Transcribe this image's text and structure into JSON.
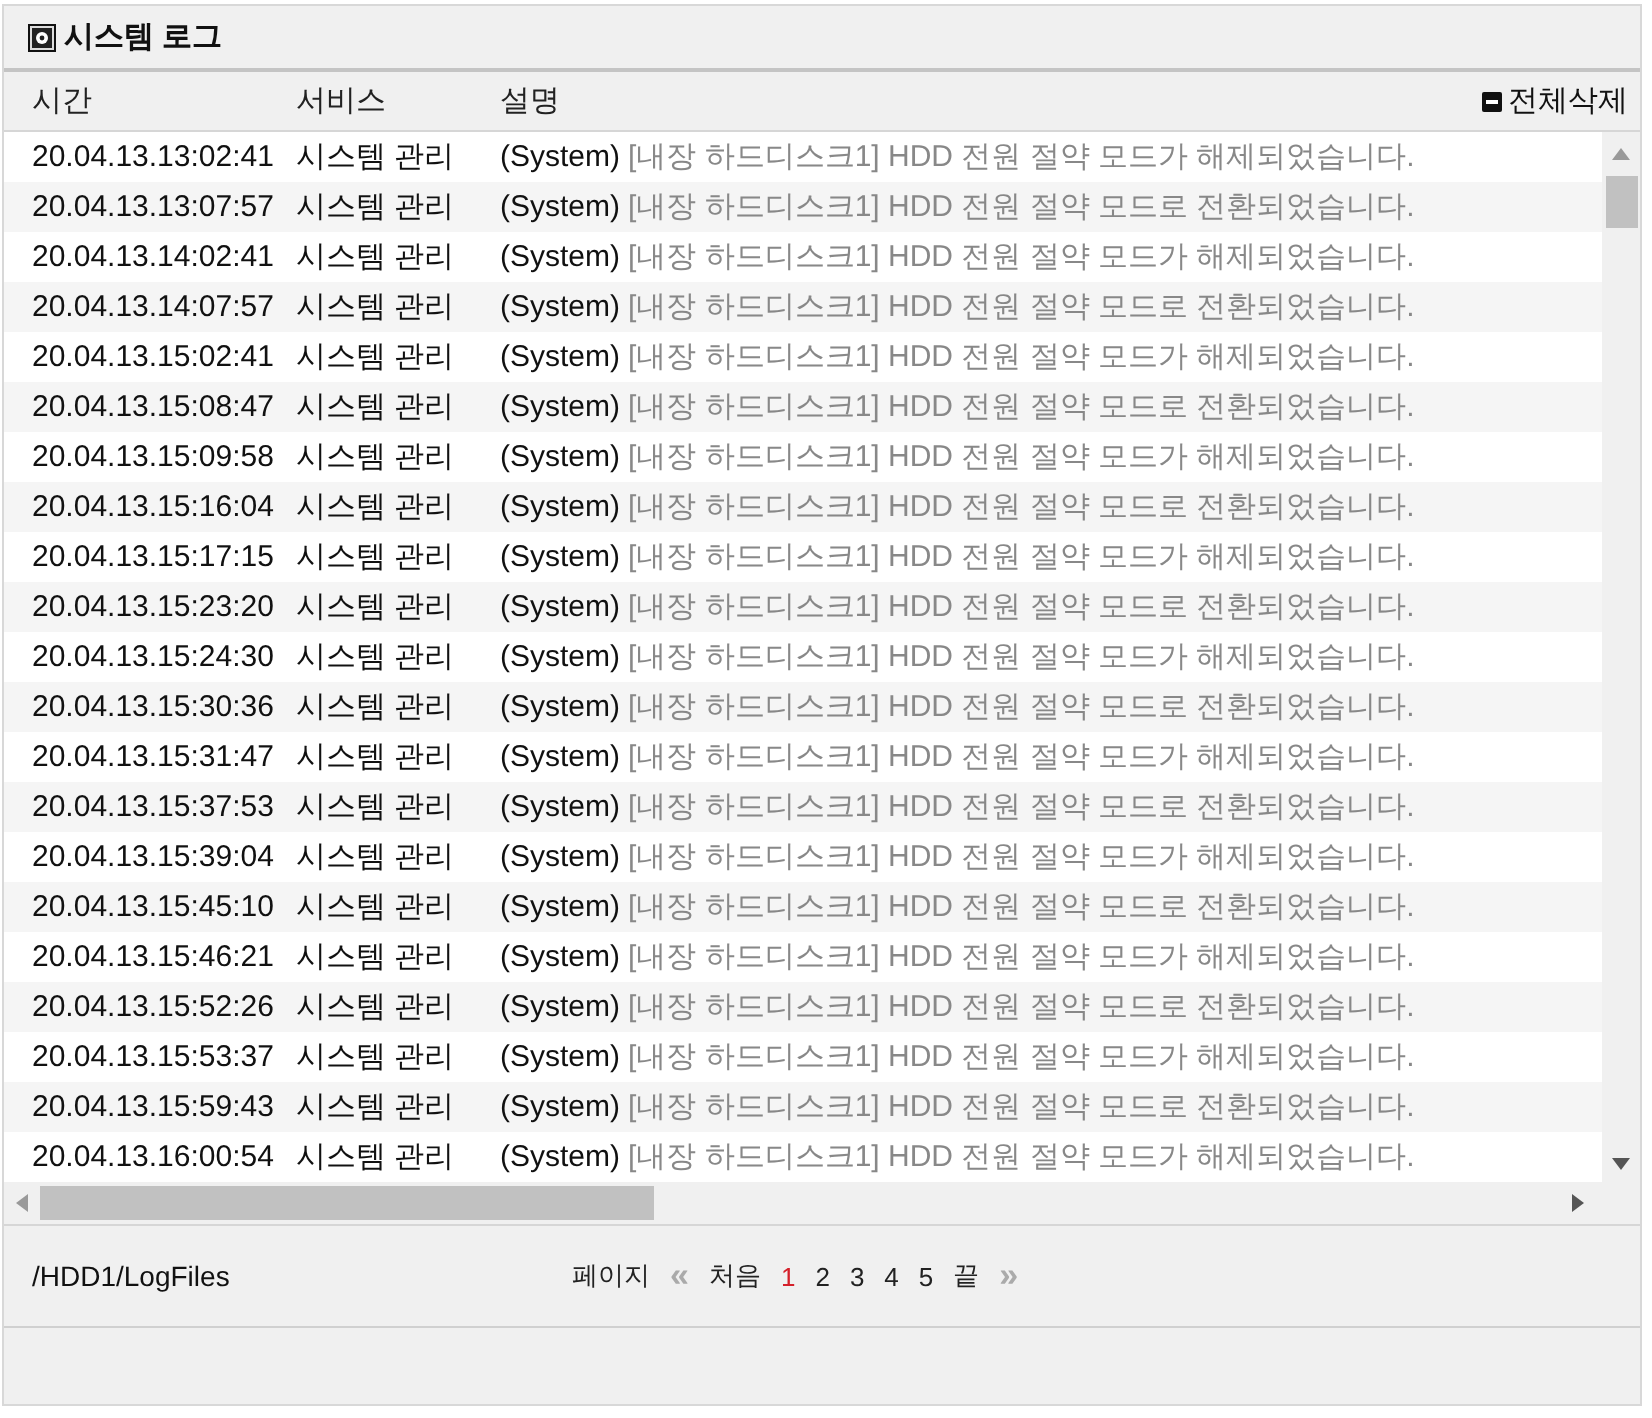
{
  "panel": {
    "title": "시스템 로그"
  },
  "table": {
    "columns": [
      "시간",
      "서비스",
      "설명"
    ],
    "delete_all": "전체삭제",
    "rows": [
      {
        "time": "20.04.13.13:02:41",
        "service": "시스템 관리",
        "source": "(System)",
        "message": "[내장 하드디스크1] HDD 전원 절약 모드가 해제되었습니다."
      },
      {
        "time": "20.04.13.13:07:57",
        "service": "시스템 관리",
        "source": "(System)",
        "message": "[내장 하드디스크1] HDD 전원 절약 모드로 전환되었습니다."
      },
      {
        "time": "20.04.13.14:02:41",
        "service": "시스템 관리",
        "source": "(System)",
        "message": "[내장 하드디스크1] HDD 전원 절약 모드가 해제되었습니다."
      },
      {
        "time": "20.04.13.14:07:57",
        "service": "시스템 관리",
        "source": "(System)",
        "message": "[내장 하드디스크1] HDD 전원 절약 모드로 전환되었습니다."
      },
      {
        "time": "20.04.13.15:02:41",
        "service": "시스템 관리",
        "source": "(System)",
        "message": "[내장 하드디스크1] HDD 전원 절약 모드가 해제되었습니다."
      },
      {
        "time": "20.04.13.15:08:47",
        "service": "시스템 관리",
        "source": "(System)",
        "message": "[내장 하드디스크1] HDD 전원 절약 모드로 전환되었습니다."
      },
      {
        "time": "20.04.13.15:09:58",
        "service": "시스템 관리",
        "source": "(System)",
        "message": "[내장 하드디스크1] HDD 전원 절약 모드가 해제되었습니다."
      },
      {
        "time": "20.04.13.15:16:04",
        "service": "시스템 관리",
        "source": "(System)",
        "message": "[내장 하드디스크1] HDD 전원 절약 모드로 전환되었습니다."
      },
      {
        "time": "20.04.13.15:17:15",
        "service": "시스템 관리",
        "source": "(System)",
        "message": "[내장 하드디스크1] HDD 전원 절약 모드가 해제되었습니다."
      },
      {
        "time": "20.04.13.15:23:20",
        "service": "시스템 관리",
        "source": "(System)",
        "message": "[내장 하드디스크1] HDD 전원 절약 모드로 전환되었습니다."
      },
      {
        "time": "20.04.13.15:24:30",
        "service": "시스템 관리",
        "source": "(System)",
        "message": "[내장 하드디스크1] HDD 전원 절약 모드가 해제되었습니다."
      },
      {
        "time": "20.04.13.15:30:36",
        "service": "시스템 관리",
        "source": "(System)",
        "message": "[내장 하드디스크1] HDD 전원 절약 모드로 전환되었습니다."
      },
      {
        "time": "20.04.13.15:31:47",
        "service": "시스템 관리",
        "source": "(System)",
        "message": "[내장 하드디스크1] HDD 전원 절약 모드가 해제되었습니다."
      },
      {
        "time": "20.04.13.15:37:53",
        "service": "시스템 관리",
        "source": "(System)",
        "message": "[내장 하드디스크1] HDD 전원 절약 모드로 전환되었습니다."
      },
      {
        "time": "20.04.13.15:39:04",
        "service": "시스템 관리",
        "source": "(System)",
        "message": "[내장 하드디스크1] HDD 전원 절약 모드가 해제되었습니다."
      },
      {
        "time": "20.04.13.15:45:10",
        "service": "시스템 관리",
        "source": "(System)",
        "message": "[내장 하드디스크1] HDD 전원 절약 모드로 전환되었습니다."
      },
      {
        "time": "20.04.13.15:46:21",
        "service": "시스템 관리",
        "source": "(System)",
        "message": "[내장 하드디스크1] HDD 전원 절약 모드가 해제되었습니다."
      },
      {
        "time": "20.04.13.15:52:26",
        "service": "시스템 관리",
        "source": "(System)",
        "message": "[내장 하드디스크1] HDD 전원 절약 모드로 전환되었습니다."
      },
      {
        "time": "20.04.13.15:53:37",
        "service": "시스템 관리",
        "source": "(System)",
        "message": "[내장 하드디스크1] HDD 전원 절약 모드가 해제되었습니다."
      },
      {
        "time": "20.04.13.15:59:43",
        "service": "시스템 관리",
        "source": "(System)",
        "message": "[내장 하드디스크1] HDD 전원 절약 모드로 전환되었습니다."
      },
      {
        "time": "20.04.13.16:00:54",
        "service": "시스템 관리",
        "source": "(System)",
        "message": "[내장 하드디스크1] HDD 전원 절약 모드가 해제되었습니다."
      }
    ]
  },
  "footer": {
    "path": "/HDD1/LogFiles",
    "pager_label": "페이지",
    "prev": "«",
    "first": "처음",
    "pages": [
      {
        "label": "1",
        "selected": true
      },
      {
        "label": "2",
        "selected": false
      },
      {
        "label": "3",
        "selected": false
      },
      {
        "label": "4",
        "selected": false
      },
      {
        "label": "5",
        "selected": false
      }
    ],
    "last": "끝",
    "next": "»"
  }
}
